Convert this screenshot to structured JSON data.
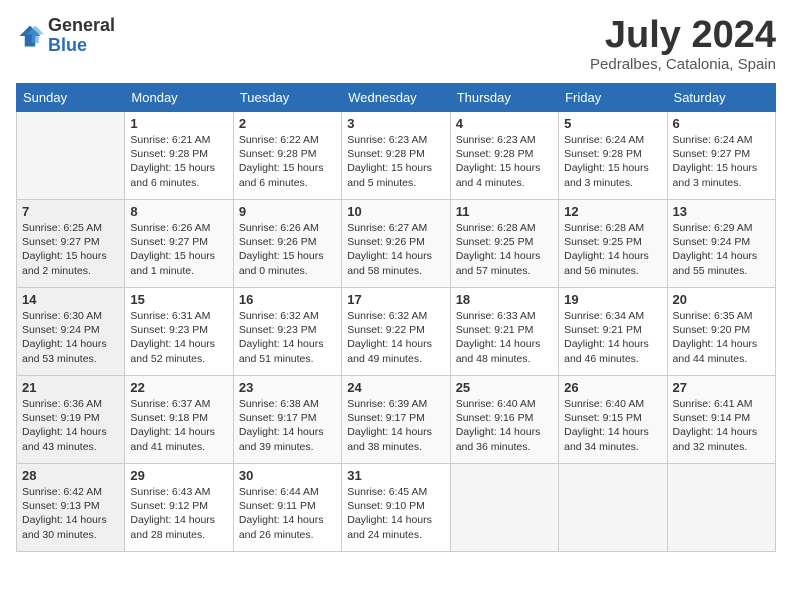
{
  "header": {
    "logo_general": "General",
    "logo_blue": "Blue",
    "month": "July 2024",
    "location": "Pedralbes, Catalonia, Spain"
  },
  "weekdays": [
    "Sunday",
    "Monday",
    "Tuesday",
    "Wednesday",
    "Thursday",
    "Friday",
    "Saturday"
  ],
  "weeks": [
    [
      {
        "day": "",
        "info": ""
      },
      {
        "day": "1",
        "info": "Sunrise: 6:21 AM\nSunset: 9:28 PM\nDaylight: 15 hours\nand 6 minutes."
      },
      {
        "day": "2",
        "info": "Sunrise: 6:22 AM\nSunset: 9:28 PM\nDaylight: 15 hours\nand 6 minutes."
      },
      {
        "day": "3",
        "info": "Sunrise: 6:23 AM\nSunset: 9:28 PM\nDaylight: 15 hours\nand 5 minutes."
      },
      {
        "day": "4",
        "info": "Sunrise: 6:23 AM\nSunset: 9:28 PM\nDaylight: 15 hours\nand 4 minutes."
      },
      {
        "day": "5",
        "info": "Sunrise: 6:24 AM\nSunset: 9:28 PM\nDaylight: 15 hours\nand 3 minutes."
      },
      {
        "day": "6",
        "info": "Sunrise: 6:24 AM\nSunset: 9:27 PM\nDaylight: 15 hours\nand 3 minutes."
      }
    ],
    [
      {
        "day": "7",
        "info": "Sunrise: 6:25 AM\nSunset: 9:27 PM\nDaylight: 15 hours\nand 2 minutes."
      },
      {
        "day": "8",
        "info": "Sunrise: 6:26 AM\nSunset: 9:27 PM\nDaylight: 15 hours\nand 1 minute."
      },
      {
        "day": "9",
        "info": "Sunrise: 6:26 AM\nSunset: 9:26 PM\nDaylight: 15 hours\nand 0 minutes."
      },
      {
        "day": "10",
        "info": "Sunrise: 6:27 AM\nSunset: 9:26 PM\nDaylight: 14 hours\nand 58 minutes."
      },
      {
        "day": "11",
        "info": "Sunrise: 6:28 AM\nSunset: 9:25 PM\nDaylight: 14 hours\nand 57 minutes."
      },
      {
        "day": "12",
        "info": "Sunrise: 6:28 AM\nSunset: 9:25 PM\nDaylight: 14 hours\nand 56 minutes."
      },
      {
        "day": "13",
        "info": "Sunrise: 6:29 AM\nSunset: 9:24 PM\nDaylight: 14 hours\nand 55 minutes."
      }
    ],
    [
      {
        "day": "14",
        "info": "Sunrise: 6:30 AM\nSunset: 9:24 PM\nDaylight: 14 hours\nand 53 minutes."
      },
      {
        "day": "15",
        "info": "Sunrise: 6:31 AM\nSunset: 9:23 PM\nDaylight: 14 hours\nand 52 minutes."
      },
      {
        "day": "16",
        "info": "Sunrise: 6:32 AM\nSunset: 9:23 PM\nDaylight: 14 hours\nand 51 minutes."
      },
      {
        "day": "17",
        "info": "Sunrise: 6:32 AM\nSunset: 9:22 PM\nDaylight: 14 hours\nand 49 minutes."
      },
      {
        "day": "18",
        "info": "Sunrise: 6:33 AM\nSunset: 9:21 PM\nDaylight: 14 hours\nand 48 minutes."
      },
      {
        "day": "19",
        "info": "Sunrise: 6:34 AM\nSunset: 9:21 PM\nDaylight: 14 hours\nand 46 minutes."
      },
      {
        "day": "20",
        "info": "Sunrise: 6:35 AM\nSunset: 9:20 PM\nDaylight: 14 hours\nand 44 minutes."
      }
    ],
    [
      {
        "day": "21",
        "info": "Sunrise: 6:36 AM\nSunset: 9:19 PM\nDaylight: 14 hours\nand 43 minutes."
      },
      {
        "day": "22",
        "info": "Sunrise: 6:37 AM\nSunset: 9:18 PM\nDaylight: 14 hours\nand 41 minutes."
      },
      {
        "day": "23",
        "info": "Sunrise: 6:38 AM\nSunset: 9:17 PM\nDaylight: 14 hours\nand 39 minutes."
      },
      {
        "day": "24",
        "info": "Sunrise: 6:39 AM\nSunset: 9:17 PM\nDaylight: 14 hours\nand 38 minutes."
      },
      {
        "day": "25",
        "info": "Sunrise: 6:40 AM\nSunset: 9:16 PM\nDaylight: 14 hours\nand 36 minutes."
      },
      {
        "day": "26",
        "info": "Sunrise: 6:40 AM\nSunset: 9:15 PM\nDaylight: 14 hours\nand 34 minutes."
      },
      {
        "day": "27",
        "info": "Sunrise: 6:41 AM\nSunset: 9:14 PM\nDaylight: 14 hours\nand 32 minutes."
      }
    ],
    [
      {
        "day": "28",
        "info": "Sunrise: 6:42 AM\nSunset: 9:13 PM\nDaylight: 14 hours\nand 30 minutes."
      },
      {
        "day": "29",
        "info": "Sunrise: 6:43 AM\nSunset: 9:12 PM\nDaylight: 14 hours\nand 28 minutes."
      },
      {
        "day": "30",
        "info": "Sunrise: 6:44 AM\nSunset: 9:11 PM\nDaylight: 14 hours\nand 26 minutes."
      },
      {
        "day": "31",
        "info": "Sunrise: 6:45 AM\nSunset: 9:10 PM\nDaylight: 14 hours\nand 24 minutes."
      },
      {
        "day": "",
        "info": ""
      },
      {
        "day": "",
        "info": ""
      },
      {
        "day": "",
        "info": ""
      }
    ]
  ]
}
